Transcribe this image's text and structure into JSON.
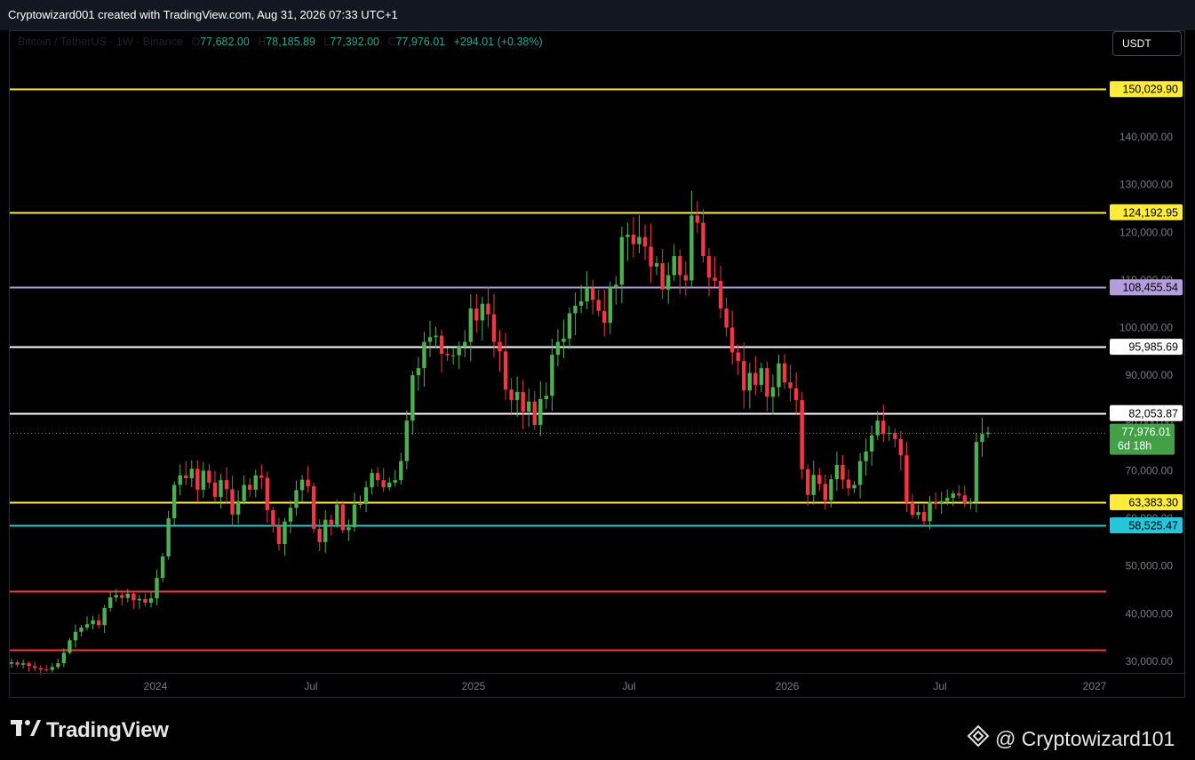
{
  "header": {
    "text": "Cryptowizard001 created with TradingView.com, Aug 31, 2026 07:33 UTC+1"
  },
  "legend": {
    "symbol": "Bitcoin / TetherUS · 1W · Binance",
    "open_label": "O",
    "open": "77,682.00",
    "high_label": "H",
    "high": "78,185.89",
    "low_label": "L",
    "low": "77,392.00",
    "close_label": "C",
    "close": "77,976.01",
    "change": "+294.01 (+0.38%)"
  },
  "currency_button": "USDT",
  "footer": {
    "brand": "TradingView",
    "watermark": "@ Cryptowizard101"
  },
  "icons": {
    "logo": "tradingview-logo-icon",
    "watermark": "binance-diamond-icon"
  },
  "colors": {
    "up": "#4caf50",
    "down": "#f23645",
    "yellow": "#ffeb3b",
    "purple": "#b39ddb",
    "cyan": "#26c6da",
    "red": "#f23645",
    "white": "#ffffff"
  },
  "chart_data": {
    "type": "candlestick",
    "title": "Bitcoin / TetherUS · 1W · Binance",
    "ylim": [
      28000,
      155000
    ],
    "y_ticks": [
      "150,000.00",
      "140,000.00",
      "130,000.00",
      "120,000.00",
      "110,000.00",
      "100,000.00",
      "90,000.00",
      "80,000.00",
      "70,000.00",
      "60,000.00",
      "50,000.00",
      "40,000.00",
      "30,000.00"
    ],
    "x_ticks": [
      "2024",
      "Jul",
      "2025",
      "Jul",
      "2026",
      "Jul",
      "2027"
    ],
    "levels": [
      {
        "label": "150,029.90",
        "value": 150029.9,
        "color": "yellow"
      },
      {
        "label": "124,192.95",
        "value": 124192.95,
        "color": "yellow"
      },
      {
        "label": "108,455.54",
        "value": 108455.54,
        "color": "purple"
      },
      {
        "label": "95,985.69",
        "value": 95985.69,
        "color": "white"
      },
      {
        "label": "82,053.87",
        "value": 82053.87,
        "color": "white"
      },
      {
        "label": "63,383.30",
        "value": 63383.3,
        "color": "yellow"
      },
      {
        "label": "58,525.47",
        "value": 58525.47,
        "color": "cyan"
      },
      {
        "value": 44800,
        "color": "red"
      },
      {
        "value": 32500,
        "color": "red"
      }
    ],
    "last_price": {
      "label": "77,976.01",
      "countdown": "6d 18h",
      "value": 77976.01
    },
    "closes": [
      29800,
      29300,
      29600,
      29000,
      28600,
      28300,
      28200,
      28800,
      29600,
      31800,
      34400,
      36200,
      37100,
      37800,
      38600,
      37600,
      41200,
      43400,
      43900,
      43300,
      44200,
      42800,
      43100,
      42300,
      43200,
      47500,
      52000,
      60000,
      67000,
      69000,
      68400,
      70400,
      66000,
      70000,
      67500,
      64500,
      68000,
      66100,
      60800,
      63600,
      67000,
      66000,
      69000,
      68500,
      61700,
      58300,
      54600,
      59300,
      62200,
      65900,
      68100,
      66700,
      57800,
      55000,
      59700,
      58700,
      62900,
      57500,
      58100,
      62900,
      63000,
      66500,
      69500,
      68000,
      66500,
      67500,
      68000,
      72000,
      80500,
      90000,
      91500,
      97000,
      98000,
      98300,
      94500,
      94200,
      94200,
      96000,
      97000,
      104000,
      101500,
      105000,
      102800,
      97000,
      95000,
      87000,
      84800,
      86500,
      82400,
      84500,
      79600,
      85000,
      85700,
      94300,
      97000,
      97700,
      103000,
      104600,
      105500,
      108200,
      105800,
      103500,
      101000,
      108400,
      109000,
      119000,
      119500,
      117500,
      119000,
      117000,
      112800,
      113500,
      108000,
      111000,
      115000,
      111000,
      109900,
      123500,
      122000,
      115000,
      110500,
      109800,
      104000,
      100000,
      94800,
      93000,
      86800,
      90500,
      88000,
      91500,
      85500,
      87500,
      92500,
      88500,
      87300,
      84800,
      70300,
      64900,
      69100,
      67200,
      63800,
      68200,
      71200,
      68100,
      66300,
      67000,
      72000,
      74000,
      77400,
      80500,
      77700,
      77900,
      76600,
      73200,
      63300,
      60700,
      61300,
      59400,
      63500,
      63000,
      63600,
      64300,
      65200,
      64800,
      63200,
      63383,
      76000,
      77682,
      77976
    ],
    "highs_lows_note": "wicks estimated from chart"
  }
}
